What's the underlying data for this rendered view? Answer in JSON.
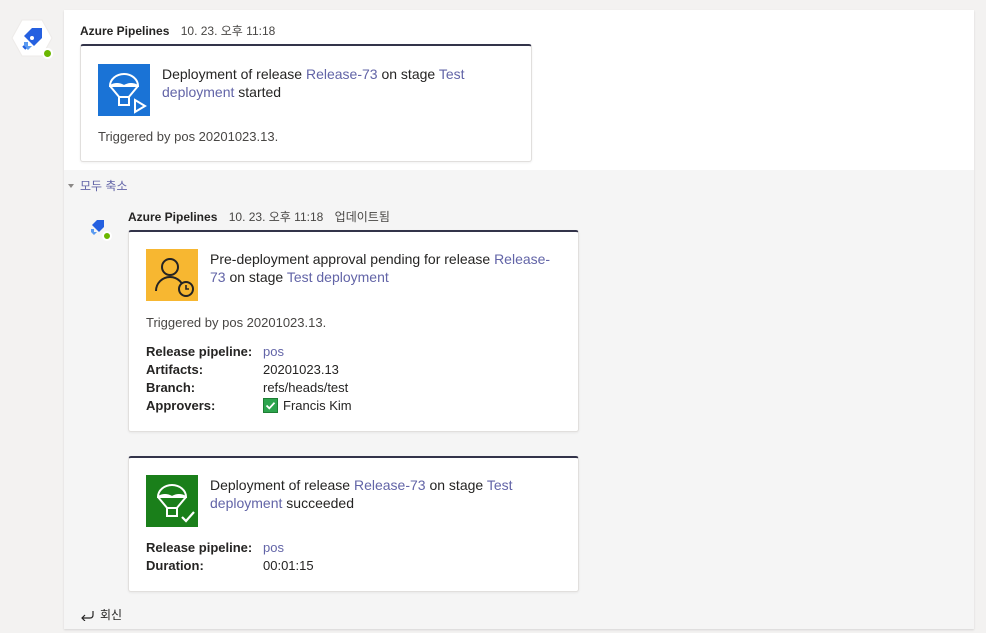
{
  "message1": {
    "sender": "Azure Pipelines",
    "timestamp": "10. 23. 오후 11:18",
    "card": {
      "title_prefix": "Deployment of release",
      "release_link": "Release-73",
      "title_mid": "on stage",
      "stage_link": "Test deployment",
      "title_suffix": "started",
      "triggered": "Triggered by pos 20201023.13."
    }
  },
  "collapse_all_label": "모두 축소",
  "message2": {
    "sender": "Azure Pipelines",
    "timestamp": "10. 23. 오후 11:18",
    "edited": "업데이트됨",
    "card_approval": {
      "title_prefix": "Pre-deployment approval pending for release",
      "release_link": "Release-73",
      "title_mid": "on stage",
      "stage_link": "Test deployment",
      "triggered": "Triggered by pos 20201023.13.",
      "facts": {
        "pipeline_key": "Release pipeline:",
        "pipeline_val": "pos",
        "artifacts_key": "Artifacts:",
        "artifacts_val": "20201023.13",
        "branch_key": "Branch:",
        "branch_val": "refs/heads/test",
        "approvers_key": "Approvers:",
        "approvers_val": "Francis Kim"
      }
    },
    "card_success": {
      "title_prefix": "Deployment of release",
      "release_link": "Release-73",
      "title_mid": "on stage",
      "stage_link": "Test deployment",
      "title_suffix": "succeeded",
      "facts": {
        "pipeline_key": "Release pipeline:",
        "pipeline_val": "pos",
        "duration_key": "Duration:",
        "duration_val": "00:01:15"
      }
    }
  },
  "reply_label": "회신",
  "icons": {
    "bot_avatar": "azure-pipelines-logo-icon",
    "online_badge": "online-status-icon",
    "deploy_started": "parachute-play-icon",
    "approval_pending": "person-clock-icon",
    "deploy_succeeded": "parachute-check-icon",
    "reply": "reply-arrow-icon",
    "collapse": "caret-down-icon"
  },
  "colors": {
    "link": "#6264a7",
    "card_border_top": "#33344a",
    "deploy_started_bg": "#1a73d6",
    "approval_bg": "#f7b731",
    "success_bg": "#1a7f1a",
    "online": "#6bb700"
  }
}
